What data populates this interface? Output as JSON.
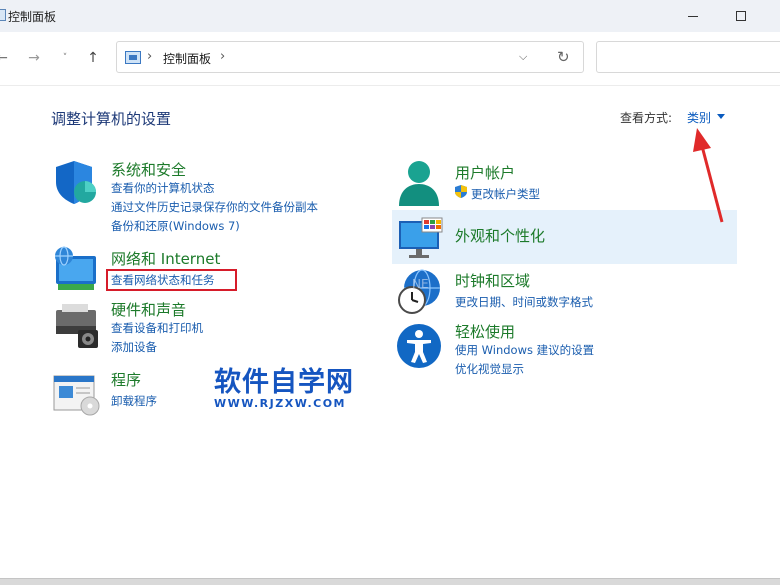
{
  "window": {
    "title": "控制面板"
  },
  "nav": {
    "back_icon": "arrow-left-icon",
    "forward_icon": "arrow-right-icon",
    "recent_icon": "chevron-down-icon",
    "up_icon": "arrow-up-icon",
    "address": {
      "separator": "›",
      "path": "控制面板",
      "trailing_separator": "›",
      "dropdown_glyph": "⌵",
      "refresh_glyph": "↻"
    },
    "search": {
      "placeholder": ""
    }
  },
  "content": {
    "title": "调整计算机的设置",
    "view_by_label": "查看方式:",
    "view_by_value": "类别"
  },
  "categories_left": [
    {
      "title": "系统和安全",
      "icon": "shield-icon",
      "links": [
        "查看你的计算机状态",
        "通过文件历史记录保存你的文件备份副本",
        "备份和还原(Windows 7)"
      ]
    },
    {
      "title": "网络和 Internet",
      "icon": "network-globe-icon",
      "links": [
        "查看网络状态和任务"
      ]
    },
    {
      "title": "硬件和声音",
      "icon": "printer-icon",
      "links": [
        "查看设备和打印机",
        "添加设备"
      ]
    },
    {
      "title": "程序",
      "icon": "programs-icon",
      "links": [
        "卸载程序"
      ]
    }
  ],
  "categories_right": [
    {
      "title": "用户帐户",
      "icon": "user-icon",
      "links": [
        "更改帐户类型"
      ]
    },
    {
      "title": "外观和个性化",
      "icon": "monitor-icon",
      "links": []
    },
    {
      "title": "时钟和区域",
      "icon": "clock-globe-icon",
      "links": [
        "更改日期、时间或数字格式"
      ]
    },
    {
      "title": "轻松使用",
      "icon": "accessibility-icon",
      "links": [
        "使用 Windows 建议的设置",
        "优化视觉显示"
      ]
    }
  ],
  "watermark": {
    "main": "软件自学网",
    "sub": "WWW.RJZXW.COM",
    "faint": "NE"
  },
  "colors": {
    "category_title": "#1c7a2a",
    "link": "#1a5dae",
    "page_title": "#1e3a78",
    "highlight": "#e5f1fb",
    "annotation_red": "#d61c2a",
    "watermark_blue": "#1555c0"
  }
}
